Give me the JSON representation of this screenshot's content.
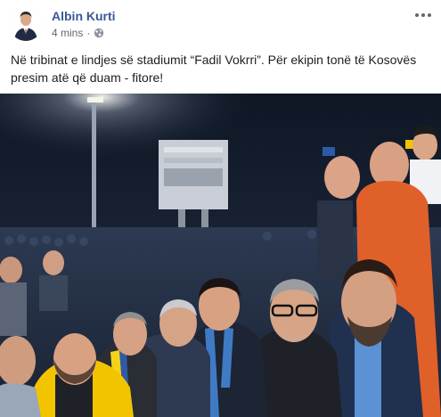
{
  "post": {
    "author": "Albin Kurti",
    "time": "4 mins",
    "separator": "·",
    "audience_icon": "globe-icon",
    "more_icon": "more-options-icon",
    "text": "Në tribinat e lindjes së stadiumit “Fadil Vokrri”. Për ekipin tonë të Kosovës presim atë që duam - fitore!"
  },
  "colors": {
    "author_link": "#365899",
    "meta_text": "#616770",
    "body_text": "#1c1e21"
  }
}
